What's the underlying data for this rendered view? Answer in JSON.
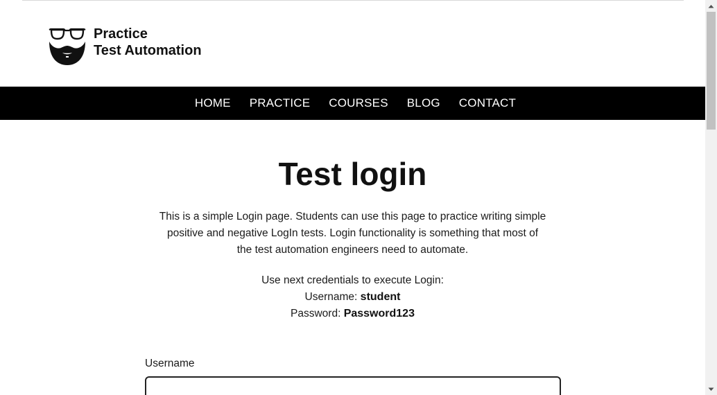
{
  "header": {
    "logo_line1": "Practice",
    "logo_line2": "Test Automation"
  },
  "nav": {
    "items": [
      {
        "label": "HOME"
      },
      {
        "label": "PRACTICE"
      },
      {
        "label": "COURSES"
      },
      {
        "label": "BLOG"
      },
      {
        "label": "CONTACT"
      }
    ]
  },
  "main": {
    "title": "Test login",
    "intro_line1": "This is a simple Login page. Students can use this page to practice writing simple",
    "intro_line2": "positive and negative LogIn tests. Login functionality is something that most of",
    "intro_line3": "the test automation engineers need to automate.",
    "creds_intro": "Use next credentials to execute Login:",
    "username_label": "Username:",
    "username_value": "student",
    "password_label": "Password:",
    "password_value": "Password123"
  },
  "form": {
    "username_field_label": "Username",
    "username_value": ""
  },
  "colors": {
    "nav_background": "#000000",
    "nav_text": "#ffffff",
    "text": "#1a1a1a",
    "scrollbar_track": "#f1f1f1",
    "scrollbar_thumb": "#c1c1c1"
  },
  "icons": {
    "logo": "glasses-beard-logo-icon",
    "scroll_up": "scroll-up-arrow-icon",
    "scroll_down": "scroll-down-arrow-icon"
  }
}
